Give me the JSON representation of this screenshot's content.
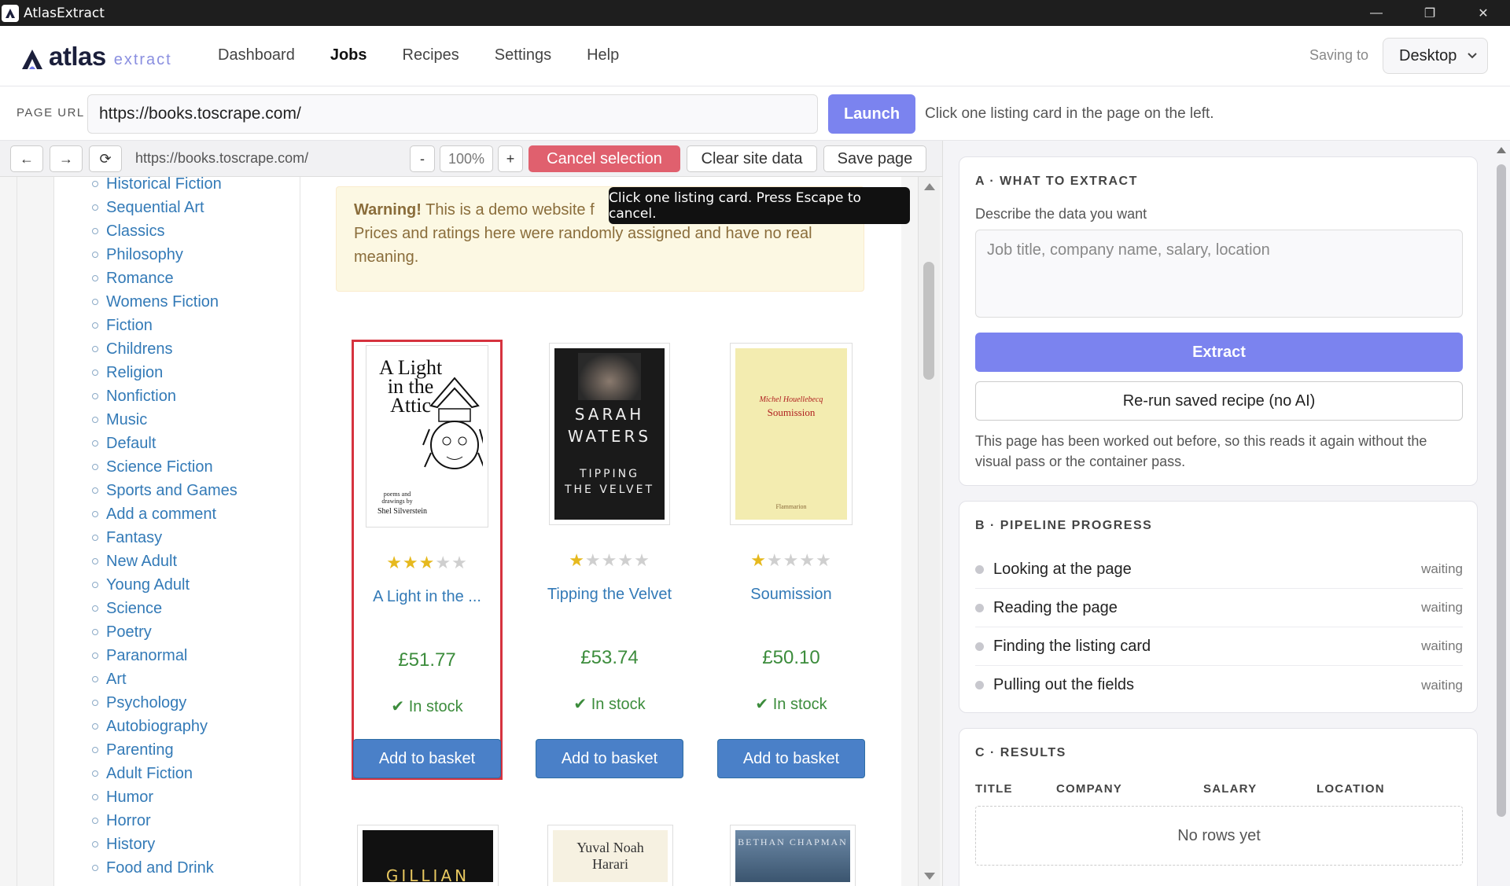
{
  "window": {
    "title": "AtlasExtract",
    "minimize": "—",
    "restore": "❐",
    "close": "✕"
  },
  "nav": {
    "logo_word": "atlas",
    "logo_sub": "extract",
    "links": [
      "Dashboard",
      "Jobs",
      "Recipes",
      "Settings",
      "Help"
    ],
    "active": "Jobs",
    "saving_label": "Saving to",
    "destination": "Desktop"
  },
  "urlbar": {
    "label": "PAGE URL",
    "url": "https://books.toscrape.com/",
    "launch": "Launch",
    "hint": "Click one listing card in the page on the left."
  },
  "browser": {
    "back": "←",
    "forward": "→",
    "reload": "⟳",
    "url": "https://books.toscrape.com/",
    "zoom_out": "-",
    "zoom": "100%",
    "zoom_in": "+",
    "cancel_selection": "Cancel selection",
    "clear_site_data": "Clear site data",
    "save_page": "Save page",
    "tooltip": "Click one listing card. Press Escape to cancel."
  },
  "site": {
    "categories": [
      "Historical Fiction",
      "Sequential Art",
      "Classics",
      "Philosophy",
      "Romance",
      "Womens Fiction",
      "Fiction",
      "Childrens",
      "Religion",
      "Nonfiction",
      "Music",
      "Default",
      "Science Fiction",
      "Sports and Games",
      "Add a comment",
      "Fantasy",
      "New Adult",
      "Young Adult",
      "Science",
      "Poetry",
      "Paranormal",
      "Art",
      "Psychology",
      "Autobiography",
      "Parenting",
      "Adult Fiction",
      "Humor",
      "Horror",
      "History",
      "Food and Drink"
    ],
    "warning_bold": "Warning!",
    "warning_text": " This is a demo website f",
    "warning_text2": "Prices and ratings here were randomly assigned and have no real meaning.",
    "products": [
      {
        "title": "A Light in the ...",
        "price": "£51.77",
        "stock": "In stock",
        "rating": 3,
        "button": "Add to basket",
        "cover": {
          "line1": "A Light",
          "line2": "in the",
          "line3": "Attic",
          "small": "poems and drawings by",
          "author": "Shel Silverstein"
        }
      },
      {
        "title": "Tipping the Velvet",
        "price": "£53.74",
        "stock": "In stock",
        "rating": 1,
        "button": "Add to basket",
        "cover": {
          "line1": "SARAH",
          "line2": "WATERS",
          "line3": "TIPPING",
          "line4": "THE VELVET"
        }
      },
      {
        "title": "Soumission",
        "price": "£50.10",
        "stock": "In stock",
        "rating": 1,
        "button": "Add to basket",
        "cover": {
          "author": "Michel Houellebecq",
          "line1": "Soumission",
          "publisher": "Flammarion"
        }
      }
    ],
    "next_row": [
      {
        "line1": "GILLIAN"
      },
      {
        "line1": "Yuval Noah",
        "line2": "Harari"
      },
      {
        "line1": "BETHAN CHAPMAN"
      }
    ]
  },
  "panel": {
    "a_heading": "A · WHAT TO EXTRACT",
    "a_desc": "Describe the data you want",
    "a_placeholder": "Job title, company name, salary, location",
    "extract": "Extract",
    "rerun": "Re-run saved recipe (no AI)",
    "note": "This page has been worked out before, so this reads it again without the visual pass or the container pass.",
    "b_heading": "B · PIPELINE PROGRESS",
    "steps": [
      {
        "name": "Looking at the page",
        "status": "waiting"
      },
      {
        "name": "Reading the page",
        "status": "waiting"
      },
      {
        "name": "Finding the listing card",
        "status": "waiting"
      },
      {
        "name": "Pulling out the fields",
        "status": "waiting"
      }
    ],
    "c_heading": "C · RESULTS",
    "columns": [
      "TITLE",
      "COMPANY",
      "SALARY",
      "LOCATION"
    ],
    "empty": "No rows yet"
  },
  "colors": {
    "accent": "#7b83ef",
    "danger": "#e0606e",
    "link": "#337ab7",
    "price": "#3c8c3c",
    "star": "#e6b91e"
  }
}
